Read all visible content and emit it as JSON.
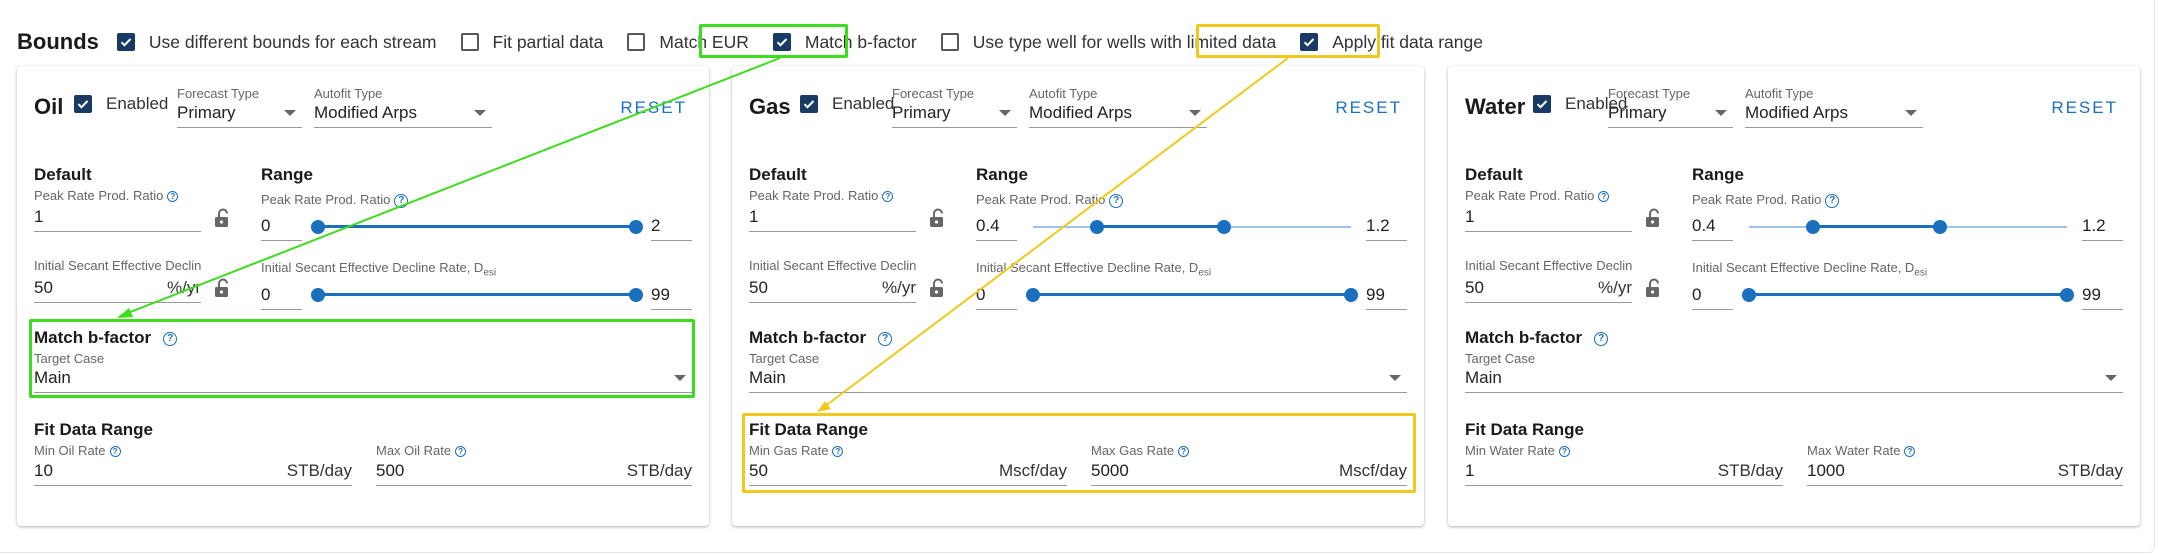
{
  "header": {
    "title": "Bounds",
    "options": [
      {
        "label": "Use different bounds for each stream",
        "checked": true
      },
      {
        "label": "Fit partial data",
        "checked": false
      },
      {
        "label": "Match EUR",
        "checked": false
      },
      {
        "label": "Match b-factor",
        "checked": true
      },
      {
        "label": "Use type well for wells with limited data",
        "checked": false
      },
      {
        "label": "Apply fit data range",
        "checked": true
      }
    ]
  },
  "common": {
    "enabled": "Enabled",
    "forecast_type_label": "Forecast Type",
    "forecast_type": "Primary",
    "autofit_type_label": "Autofit Type",
    "autofit_type": "Modified Arps",
    "reset": "RESET",
    "default": "Default",
    "range": "Range",
    "peak_label": "Peak Rate Prod. Ratio",
    "decline_label_short": "Initial Secant Effective Decline F",
    "decline_label": "Initial Secant Effective Decline Rate, D",
    "decline_sub": "esi",
    "decline_unit": "%/yr",
    "match_title": "Match b-factor",
    "target_case_label": "Target Case",
    "target_case": "Main",
    "fit_title": "Fit Data Range",
    "info_glyph": "?"
  },
  "streams": [
    {
      "name": "Oil",
      "enabled": true,
      "peak_default": "1",
      "peak_min": "0",
      "peak_max": "2",
      "peak_slider": [
        0,
        1
      ],
      "decline_default": "50",
      "decline_min": "0",
      "decline_max": "99",
      "decline_slider": [
        0,
        1
      ],
      "min_rate_label": "Min Oil Rate",
      "min_rate": "10",
      "max_rate_label": "Max Oil Rate",
      "max_rate": "500",
      "rate_unit": "STB/day"
    },
    {
      "name": "Gas",
      "enabled": true,
      "peak_default": "1",
      "peak_min": "0.4",
      "peak_max": "1.2",
      "peak_slider": [
        0.2,
        0.6
      ],
      "decline_default": "50",
      "decline_min": "0",
      "decline_max": "99",
      "decline_slider": [
        0,
        1
      ],
      "min_rate_label": "Min Gas Rate",
      "min_rate": "50",
      "max_rate_label": "Max Gas Rate",
      "max_rate": "5000",
      "rate_unit": "Mscf/day"
    },
    {
      "name": "Water",
      "enabled": true,
      "peak_default": "1",
      "peak_min": "0.4",
      "peak_max": "1.2",
      "peak_slider": [
        0.2,
        0.6
      ],
      "decline_default": "50",
      "decline_min": "0",
      "decline_max": "99",
      "decline_slider": [
        0,
        1
      ],
      "min_rate_label": "Min Water Rate",
      "min_rate": "1",
      "max_rate_label": "Max Water Rate",
      "max_rate": "1000",
      "rate_unit": "STB/day"
    }
  ],
  "colors": {
    "accent": "#1a6fbf",
    "checkbox": "#1a3a66",
    "highlight_green": "#3ddc1e",
    "highlight_yellow": "#f2c81c"
  }
}
